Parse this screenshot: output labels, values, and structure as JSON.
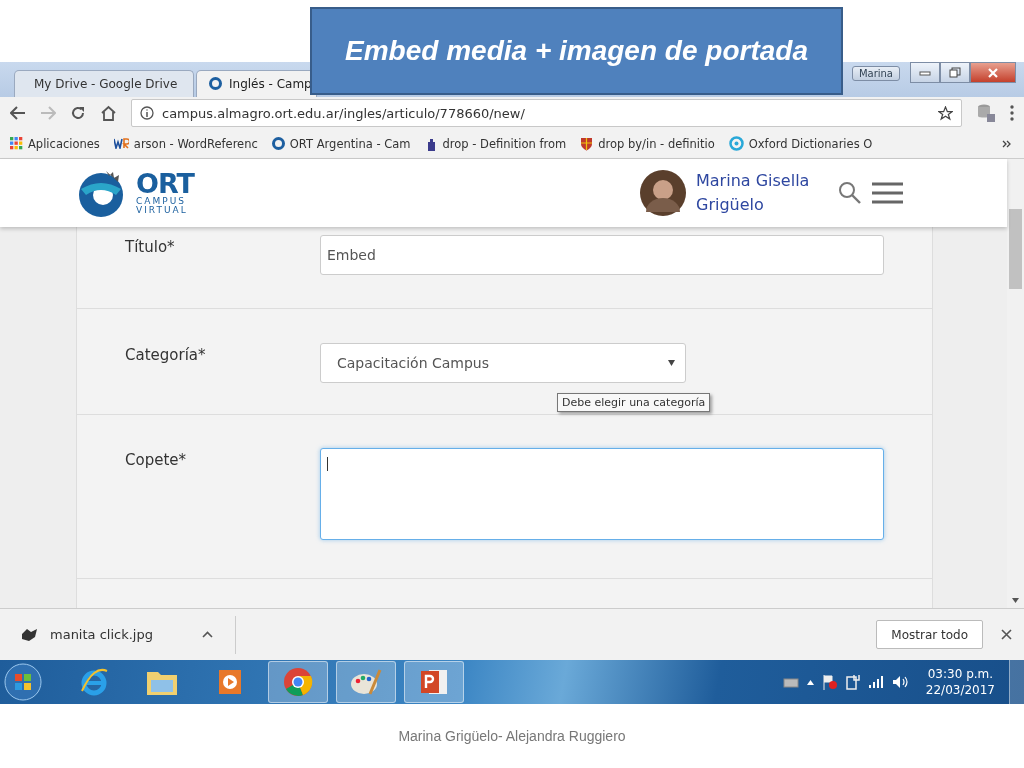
{
  "slide": {
    "title": "Embed media + imagen de portada",
    "footer": "Marina Grigüelo- Alejandra Ruggiero"
  },
  "browser": {
    "user_badge": "Marina",
    "tabs": [
      {
        "label": "My Drive - Google Drive",
        "selected": false
      },
      {
        "label": "Inglés - Camp",
        "selected": true
      }
    ],
    "url": "campus.almagro.ort.edu.ar/ingles/articulo/778660/new/",
    "bookmarks": [
      {
        "label": "Aplicaciones"
      },
      {
        "label": "arson - WordReferenc"
      },
      {
        "label": "ORT Argentina - Cam"
      },
      {
        "label": "drop - Definition from"
      },
      {
        "label": "drop by/in - definitio"
      },
      {
        "label": "Oxford Dictionaries O"
      }
    ]
  },
  "site": {
    "logo": {
      "name": "ORT",
      "line1": "CAMPUS",
      "line2": "VIRTUAL"
    },
    "user": "Marina Gisella Grigüelo"
  },
  "form": {
    "fields": [
      {
        "label": "Título*",
        "kind": "input",
        "value": "Embed",
        "focused": false
      },
      {
        "label": "Categoría*",
        "kind": "select",
        "value": "Capacitación Campus",
        "focused": false
      },
      {
        "label": "Copete*",
        "kind": "textarea",
        "focused": true
      }
    ],
    "tooltip": "Debe elegir una categoría"
  },
  "download": {
    "file": "manita click.jpg",
    "button": "Mostrar todo"
  },
  "taskbar": {
    "apps": [
      {
        "kind": "ie",
        "selected": false
      },
      {
        "kind": "folder",
        "selected": false
      },
      {
        "kind": "media",
        "selected": false
      },
      {
        "kind": "chrome",
        "selected": true
      },
      {
        "kind": "paint",
        "selected": true
      },
      {
        "kind": "powerpoint",
        "selected": true
      }
    ],
    "time": "03:30 p.m.",
    "date": "22/03/2017"
  }
}
